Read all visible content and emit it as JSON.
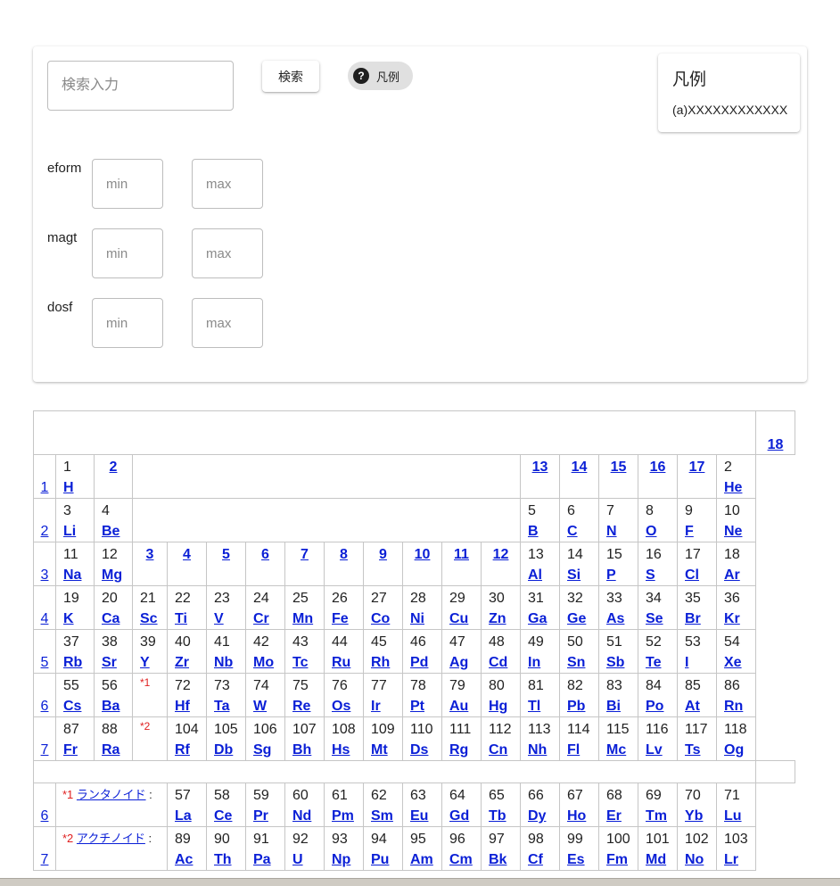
{
  "search": {
    "placeholder": "検索入力",
    "button_label": "検索",
    "legend_chip_label": "凡例",
    "help_icon_glyph": "?"
  },
  "legend": {
    "title": "凡例",
    "text": "(a)XXXXXXXXXXXX"
  },
  "filters": [
    {
      "label": "eform",
      "min_placeholder": "min",
      "max_placeholder": "max"
    },
    {
      "label": "magt",
      "min_placeholder": "min",
      "max_placeholder": "max"
    },
    {
      "label": "dosf",
      "min_placeholder": "min",
      "max_placeholder": "max"
    }
  ],
  "groups": [
    "1",
    "2",
    "3",
    "4",
    "5",
    "6",
    "7",
    "8",
    "9",
    "10",
    "11",
    "12",
    "13",
    "14",
    "15",
    "16",
    "17",
    "18"
  ],
  "periods": [
    "1",
    "2",
    "3",
    "4",
    "5",
    "6",
    "7"
  ],
  "markers": {
    "lanthanoid": "*1",
    "actinoid": "*2"
  },
  "series": {
    "lanthanoid_period": "6",
    "actinoid_period": "7",
    "lanthanoid_label": "ランタノイド",
    "actinoid_label": "アクチノイド",
    "colon": ":"
  },
  "elements": [
    {
      "n": "1",
      "s": "H"
    },
    {
      "n": "2",
      "s": "He"
    },
    {
      "n": "3",
      "s": "Li"
    },
    {
      "n": "4",
      "s": "Be"
    },
    {
      "n": "5",
      "s": "B"
    },
    {
      "n": "6",
      "s": "C"
    },
    {
      "n": "7",
      "s": "N"
    },
    {
      "n": "8",
      "s": "O"
    },
    {
      "n": "9",
      "s": "F"
    },
    {
      "n": "10",
      "s": "Ne"
    },
    {
      "n": "11",
      "s": "Na"
    },
    {
      "n": "12",
      "s": "Mg"
    },
    {
      "n": "13",
      "s": "Al"
    },
    {
      "n": "14",
      "s": "Si"
    },
    {
      "n": "15",
      "s": "P"
    },
    {
      "n": "16",
      "s": "S"
    },
    {
      "n": "17",
      "s": "Cl"
    },
    {
      "n": "18",
      "s": "Ar"
    },
    {
      "n": "19",
      "s": "K"
    },
    {
      "n": "20",
      "s": "Ca"
    },
    {
      "n": "21",
      "s": "Sc"
    },
    {
      "n": "22",
      "s": "Ti"
    },
    {
      "n": "23",
      "s": "V"
    },
    {
      "n": "24",
      "s": "Cr"
    },
    {
      "n": "25",
      "s": "Mn"
    },
    {
      "n": "26",
      "s": "Fe"
    },
    {
      "n": "27",
      "s": "Co"
    },
    {
      "n": "28",
      "s": "Ni"
    },
    {
      "n": "29",
      "s": "Cu"
    },
    {
      "n": "30",
      "s": "Zn"
    },
    {
      "n": "31",
      "s": "Ga"
    },
    {
      "n": "32",
      "s": "Ge"
    },
    {
      "n": "33",
      "s": "As"
    },
    {
      "n": "34",
      "s": "Se"
    },
    {
      "n": "35",
      "s": "Br"
    },
    {
      "n": "36",
      "s": "Kr"
    },
    {
      "n": "37",
      "s": "Rb"
    },
    {
      "n": "38",
      "s": "Sr"
    },
    {
      "n": "39",
      "s": "Y"
    },
    {
      "n": "40",
      "s": "Zr"
    },
    {
      "n": "41",
      "s": "Nb"
    },
    {
      "n": "42",
      "s": "Mo"
    },
    {
      "n": "43",
      "s": "Tc"
    },
    {
      "n": "44",
      "s": "Ru"
    },
    {
      "n": "45",
      "s": "Rh"
    },
    {
      "n": "46",
      "s": "Pd"
    },
    {
      "n": "47",
      "s": "Ag"
    },
    {
      "n": "48",
      "s": "Cd"
    },
    {
      "n": "49",
      "s": "In"
    },
    {
      "n": "50",
      "s": "Sn"
    },
    {
      "n": "51",
      "s": "Sb"
    },
    {
      "n": "52",
      "s": "Te"
    },
    {
      "n": "53",
      "s": "I"
    },
    {
      "n": "54",
      "s": "Xe"
    },
    {
      "n": "55",
      "s": "Cs"
    },
    {
      "n": "56",
      "s": "Ba"
    },
    {
      "n": "57",
      "s": "La"
    },
    {
      "n": "58",
      "s": "Ce"
    },
    {
      "n": "59",
      "s": "Pr"
    },
    {
      "n": "60",
      "s": "Nd"
    },
    {
      "n": "61",
      "s": "Pm"
    },
    {
      "n": "62",
      "s": "Sm"
    },
    {
      "n": "63",
      "s": "Eu"
    },
    {
      "n": "64",
      "s": "Gd"
    },
    {
      "n": "65",
      "s": "Tb"
    },
    {
      "n": "66",
      "s": "Dy"
    },
    {
      "n": "67",
      "s": "Ho"
    },
    {
      "n": "68",
      "s": "Er"
    },
    {
      "n": "69",
      "s": "Tm"
    },
    {
      "n": "70",
      "s": "Yb"
    },
    {
      "n": "71",
      "s": "Lu"
    },
    {
      "n": "72",
      "s": "Hf"
    },
    {
      "n": "73",
      "s": "Ta"
    },
    {
      "n": "74",
      "s": "W"
    },
    {
      "n": "75",
      "s": "Re"
    },
    {
      "n": "76",
      "s": "Os"
    },
    {
      "n": "77",
      "s": "Ir"
    },
    {
      "n": "78",
      "s": "Pt"
    },
    {
      "n": "79",
      "s": "Au"
    },
    {
      "n": "80",
      "s": "Hg"
    },
    {
      "n": "81",
      "s": "Tl"
    },
    {
      "n": "82",
      "s": "Pb"
    },
    {
      "n": "83",
      "s": "Bi"
    },
    {
      "n": "84",
      "s": "Po"
    },
    {
      "n": "85",
      "s": "At"
    },
    {
      "n": "86",
      "s": "Rn"
    },
    {
      "n": "87",
      "s": "Fr"
    },
    {
      "n": "88",
      "s": "Ra"
    },
    {
      "n": "89",
      "s": "Ac"
    },
    {
      "n": "90",
      "s": "Th"
    },
    {
      "n": "91",
      "s": "Pa"
    },
    {
      "n": "92",
      "s": "U"
    },
    {
      "n": "93",
      "s": "Np"
    },
    {
      "n": "94",
      "s": "Pu"
    },
    {
      "n": "95",
      "s": "Am"
    },
    {
      "n": "96",
      "s": "Cm"
    },
    {
      "n": "97",
      "s": "Bk"
    },
    {
      "n": "98",
      "s": "Cf"
    },
    {
      "n": "99",
      "s": "Es"
    },
    {
      "n": "100",
      "s": "Fm"
    },
    {
      "n": "101",
      "s": "Md"
    },
    {
      "n": "102",
      "s": "No"
    },
    {
      "n": "103",
      "s": "Lr"
    },
    {
      "n": "104",
      "s": "Rf"
    },
    {
      "n": "105",
      "s": "Db"
    },
    {
      "n": "106",
      "s": "Sg"
    },
    {
      "n": "107",
      "s": "Bh"
    },
    {
      "n": "108",
      "s": "Hs"
    },
    {
      "n": "109",
      "s": "Mt"
    },
    {
      "n": "110",
      "s": "Ds"
    },
    {
      "n": "111",
      "s": "Rg"
    },
    {
      "n": "112",
      "s": "Cn"
    },
    {
      "n": "113",
      "s": "Nh"
    },
    {
      "n": "114",
      "s": "Fl"
    },
    {
      "n": "115",
      "s": "Mc"
    },
    {
      "n": "116",
      "s": "Lv"
    },
    {
      "n": "117",
      "s": "Ts"
    },
    {
      "n": "118",
      "s": "Og"
    }
  ],
  "colors": {
    "link": "#0a1fd6",
    "marker": "#e02020",
    "border": "#c6c6c6"
  }
}
